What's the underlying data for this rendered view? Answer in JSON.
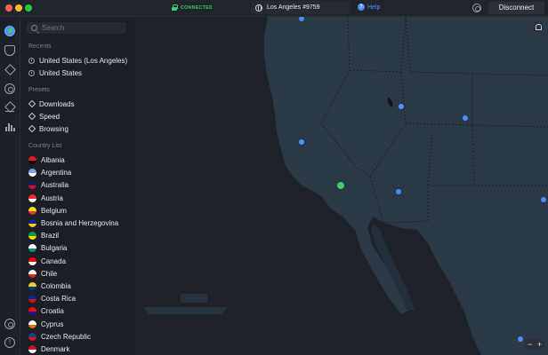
{
  "titlebar": {
    "status": "CONNECTED",
    "server": "Los Angeles #9759",
    "help": "Help",
    "disconnect": "Disconnect"
  },
  "rail": {
    "icons": [
      "globe-icon",
      "shield-icon",
      "meshnet-icon",
      "target-icon",
      "layers-icon",
      "stats-icon",
      "settings-icon",
      "info-icon"
    ]
  },
  "sidebar": {
    "search_placeholder": "Search",
    "recents_heading": "Recents",
    "recents": [
      "United States (Los Angeles)",
      "United States"
    ],
    "presets_heading": "Presets",
    "presets": [
      "Downloads",
      "Speed",
      "Browsing"
    ],
    "countries_heading": "Country List",
    "countries": [
      {
        "name": "Albania",
        "colors": [
          "#e41e20",
          "#000000"
        ]
      },
      {
        "name": "Argentina",
        "colors": [
          "#74acdf",
          "#ffffff"
        ]
      },
      {
        "name": "Australia",
        "colors": [
          "#012169",
          "#e4002b"
        ]
      },
      {
        "name": "Austria",
        "colors": [
          "#ed2939",
          "#ffffff"
        ]
      },
      {
        "name": "Belgium",
        "colors": [
          "#fdda24",
          "#ef3340"
        ]
      },
      {
        "name": "Bosnia and Herzegovina",
        "colors": [
          "#002395",
          "#fecb00"
        ]
      },
      {
        "name": "Brazil",
        "colors": [
          "#009c3b",
          "#ffdf00"
        ]
      },
      {
        "name": "Bulgaria",
        "colors": [
          "#ffffff",
          "#00966e"
        ]
      },
      {
        "name": "Canada",
        "colors": [
          "#ff0000",
          "#ffffff"
        ]
      },
      {
        "name": "Chile",
        "colors": [
          "#ffffff",
          "#d52b1e"
        ]
      },
      {
        "name": "Colombia",
        "colors": [
          "#fcd116",
          "#003893"
        ]
      },
      {
        "name": "Costa Rica",
        "colors": [
          "#002b7f",
          "#ce1126"
        ]
      },
      {
        "name": "Croatia",
        "colors": [
          "#ff0000",
          "#171796"
        ]
      },
      {
        "name": "Cyprus",
        "colors": [
          "#ffffff",
          "#d57800"
        ]
      },
      {
        "name": "Czech Republic",
        "colors": [
          "#11457e",
          "#d7141a"
        ]
      },
      {
        "name": "Denmark",
        "colors": [
          "#c8102e",
          "#ffffff"
        ]
      }
    ]
  },
  "colors": {
    "accent": "#4c8dff",
    "connected": "#3ccf6b",
    "map_land": "#2b3846",
    "map_sea": "#1e2329"
  }
}
